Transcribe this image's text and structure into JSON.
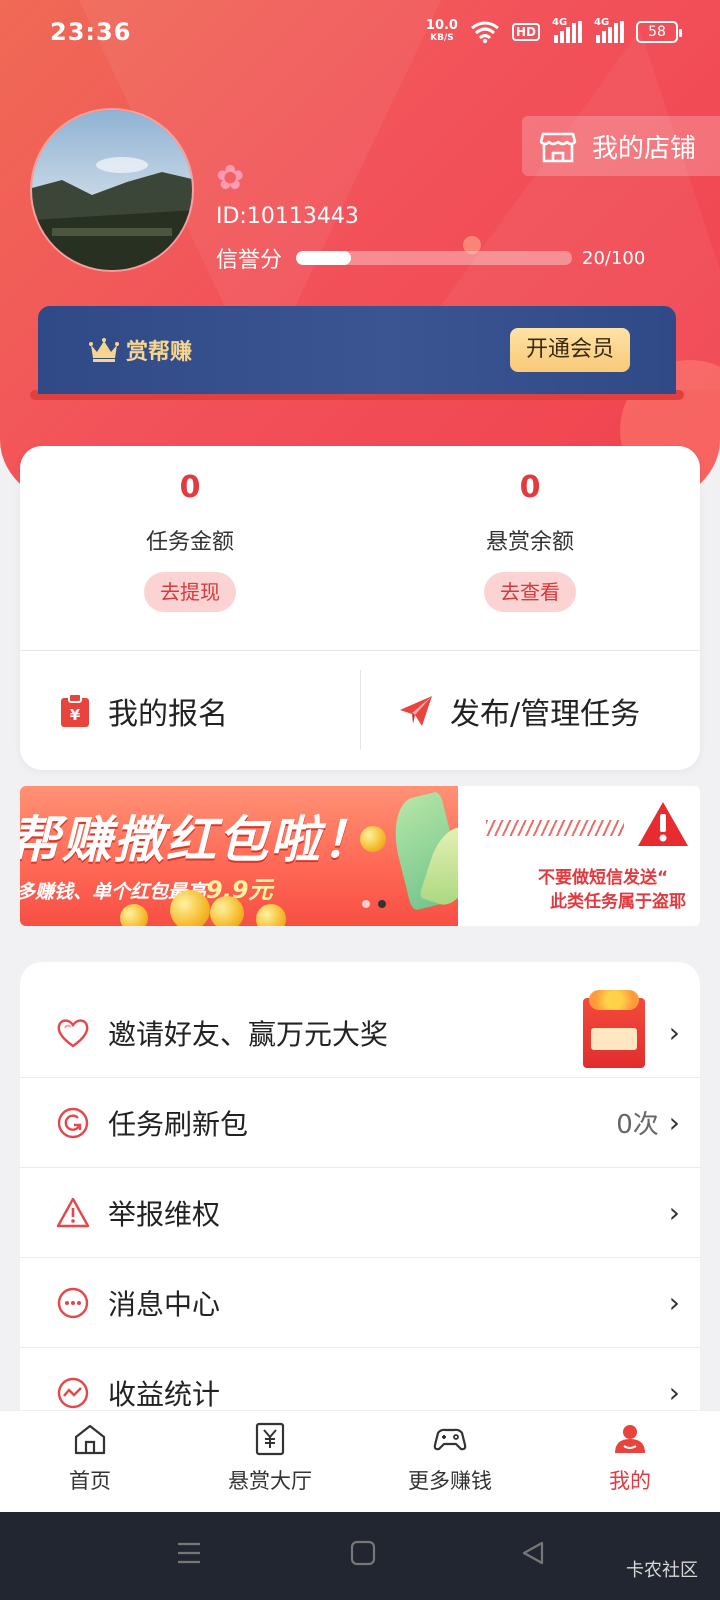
{
  "status_bar": {
    "time": "23:36",
    "net_speed_value": "10.0",
    "net_speed_unit": "KB/S",
    "hd_label": "HD",
    "signal1_tag": "4G",
    "signal2_tag": "4G",
    "battery": "58"
  },
  "profile": {
    "user_id": "ID:10113443",
    "credit_label": "信誉分",
    "credit_value": 20,
    "credit_max": 100,
    "credit_text": "20/100",
    "shop_button": "我的店铺"
  },
  "vip": {
    "title": "赏帮赚",
    "button": "开通会员"
  },
  "stats": {
    "task_amount": {
      "value": "0",
      "label": "任务金额",
      "button": "去提现"
    },
    "reward_balance": {
      "value": "0",
      "label": "悬赏余额",
      "button": "去查看"
    }
  },
  "actions": {
    "my_signups": "我的报名",
    "publish_manage": "发布/管理任务"
  },
  "banner": {
    "title": "帮赚撒红包啦！",
    "subtitle_prefix": "多赚钱、单个红包最高",
    "subtitle_amount": "9.9元",
    "warning_line1": "不要做短信发送“",
    "warning_line2": "此类任务属于盗耶"
  },
  "menu": [
    {
      "label": "邀请好友、赢万元大奖",
      "icon": "heart-icon"
    },
    {
      "label": "任务刷新包",
      "icon": "refresh-icon",
      "count": "0次"
    },
    {
      "label": "举报维权",
      "icon": "warning-icon"
    },
    {
      "label": "消息中心",
      "icon": "message-icon"
    },
    {
      "label": "收益统计",
      "icon": "stats-icon"
    }
  ],
  "tabs": [
    {
      "label": "首页",
      "icon": "home-icon"
    },
    {
      "label": "悬赏大厅",
      "icon": "yuan-doc-icon"
    },
    {
      "label": "更多赚钱",
      "icon": "gamepad-icon"
    },
    {
      "label": "我的",
      "icon": "user-icon",
      "active": true
    }
  ],
  "watermark": "卡农社区",
  "colors": {
    "header_red": "#f2525a",
    "accent_red": "#e23a3e",
    "vip_blue": "#2f4a86",
    "vip_gold": "#f7d58f"
  }
}
